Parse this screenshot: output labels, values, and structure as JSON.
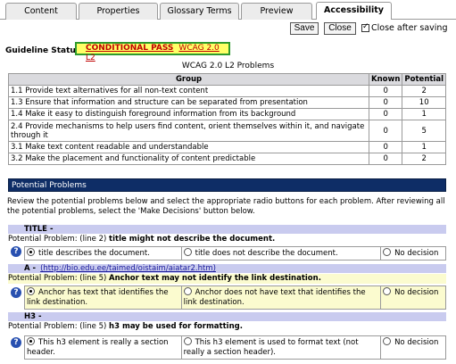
{
  "tabs": [
    "Content",
    "Properties",
    "Glossary Terms",
    "Preview",
    "Accessibility"
  ],
  "active_tab": "Accessibility",
  "toolbar": {
    "save_label": "Save",
    "close_label": "Close",
    "close_after_saving_label": "Close after saving",
    "close_after_saving_checked": true
  },
  "status": {
    "label": "Guideline Status:",
    "result": "CONDITIONAL PASS",
    "guideline": "WCAG 2.0 L2"
  },
  "problems_caption": "WCAG 2.0 L2 Problems",
  "problems_table": {
    "headers": [
      "Group",
      "Known",
      "Potential"
    ],
    "rows": [
      {
        "group": "1.1 Provide text alternatives for all non-text content",
        "known": "0",
        "potential": "2"
      },
      {
        "group": "1.3 Ensure that information and structure can be separated from presentation",
        "known": "0",
        "potential": "10"
      },
      {
        "group": "1.4 Make it easy to distinguish foreground information from its background",
        "known": "0",
        "potential": "1"
      },
      {
        "group": "2.4 Provide mechanisms to help users find content, orient themselves within it, and navigate through it",
        "known": "0",
        "potential": "5"
      },
      {
        "group": "3.1 Make text content readable and understandable",
        "known": "0",
        "potential": "1"
      },
      {
        "group": "3.2 Make the placement and functionality of content predictable",
        "known": "0",
        "potential": "2"
      }
    ]
  },
  "potential_problems_bar": "Potential Problems",
  "intro_text": "Review the potential problems below and select the appropriate radio buttons for each problem. After reviewing all the potential problems, select the 'Make Decisions' button below.",
  "sections": [
    {
      "heading": "TITLE -",
      "link": "",
      "problem_prefix": "Potential Problem: (line 2) ",
      "problem_bold": "title might not describe the document.",
      "choices": [
        "title describes the document.",
        "title does not describe the document.",
        "No decision"
      ],
      "selected": 0
    },
    {
      "heading": "A -",
      "link": "(http://bio.edu.ee/taimed/oistaim/aiatar2.htm)",
      "problem_prefix": "Potential Problem: (line 5) ",
      "problem_bold": "Anchor text may not identify the link destination.",
      "choices": [
        "Anchor has text that identifies the link destination.",
        "Anchor does not have text that identifies the link destination.",
        "No decision"
      ],
      "selected": 0
    },
    {
      "heading": "H3 -",
      "link": "",
      "problem_prefix": "Potential Problem: (line 5) ",
      "problem_bold": "h3 may be used for formatting.",
      "choices": [
        "This h3 element is really a section header.",
        "This h3 element is used to format text (not really a section header).",
        "No decision"
      ],
      "selected": 0
    }
  ],
  "help_icon_glyph": "?",
  "icons": {
    "help": "help-icon",
    "checkbox": "checkbox-checked-icon"
  },
  "colors": {
    "status_bg": "#ffff66",
    "status_border": "#2e9a2e",
    "status_text": "#c00000",
    "bar_bg": "#0e2d66",
    "section_head_bg": "#c9cbef",
    "highlight_row": "#fbfbcf"
  }
}
